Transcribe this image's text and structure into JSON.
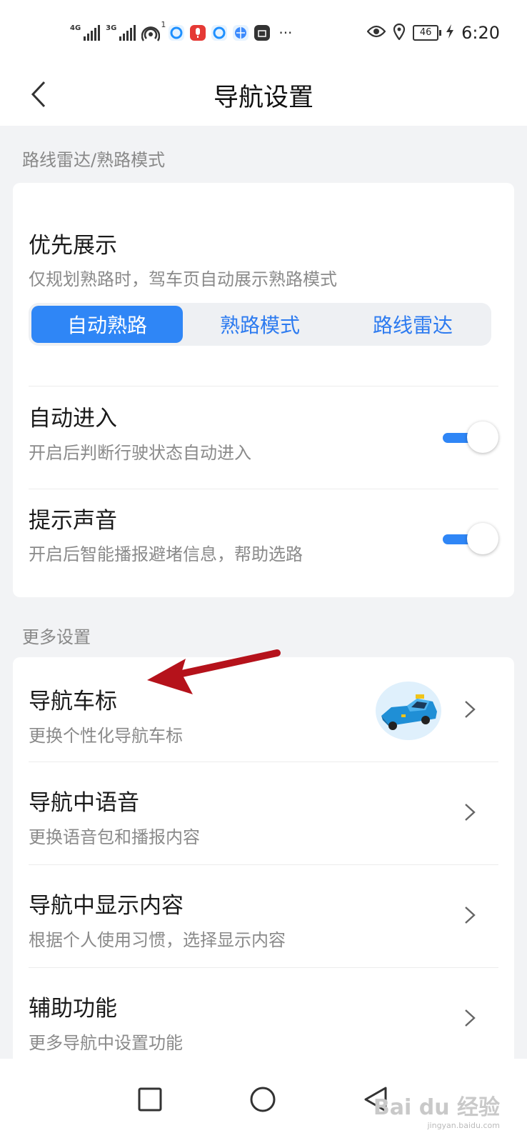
{
  "status_bar": {
    "network_1": "4G",
    "network_2": "3G",
    "hotspot_count": "1",
    "more": "···",
    "battery": "46",
    "time": "6:20"
  },
  "header": {
    "title": "导航设置"
  },
  "section_route": {
    "label": "路线雷达/熟路模式",
    "priority": {
      "title": "优先展示",
      "subtitle": "仅规划熟路时，驾车页自动展示熟路模式",
      "options": [
        "自动熟路",
        "熟路模式",
        "路线雷达"
      ],
      "selected": "自动熟路"
    },
    "auto_enter": {
      "title": "自动进入",
      "subtitle": "开启后判断行驶状态自动进入",
      "enabled": true
    },
    "sound": {
      "title": "提示声音",
      "subtitle": "开启后智能播报避堵信息，帮助选路",
      "enabled": true
    }
  },
  "section_more": {
    "label": "更多设置",
    "items": [
      {
        "title": "导航车标",
        "subtitle": "更换个性化导航车标"
      },
      {
        "title": "导航中语音",
        "subtitle": "更换语音包和播报内容"
      },
      {
        "title": "导航中显示内容",
        "subtitle": "根据个人使用习惯，选择显示内容"
      },
      {
        "title": "辅助功能",
        "subtitle": "更多导航中设置功能"
      }
    ]
  },
  "watermark": {
    "brand": "Bai du 经验",
    "site": "jingyan.baidu.com"
  },
  "colors": {
    "accent": "#2f86f6",
    "background": "#f2f3f5",
    "annotation_arrow": "#b5121b"
  }
}
